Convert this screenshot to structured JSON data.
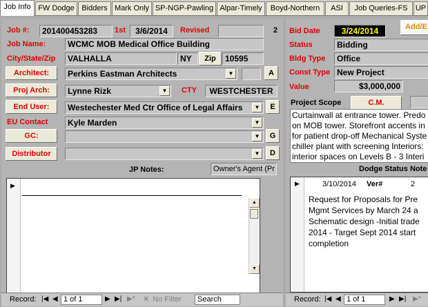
{
  "tabs": [
    "Job Info",
    "FW Dodge",
    "Bidders",
    "Mark Only",
    "SP-NGP-Pawling",
    "Alpar-Timely",
    "Boyd-Northern",
    "ASI",
    "Job Queries-FS",
    "UP"
  ],
  "left": {
    "job_no_label": "Job #:",
    "job_no": "201400453283",
    "first_label": "1st",
    "first_date": "3/6/2014",
    "revised_label": "Revised",
    "revised_value": "",
    "revision_count": "2",
    "job_name_label": "Job Name:",
    "job_name": "WCMC MOB Medical Office Building",
    "city_label": "City/State/Zip",
    "city": "VALHALLA",
    "state": "NY",
    "zip_button": "Zip",
    "zip": "10595",
    "architect_button": "Architect:",
    "architect": "Perkins Eastman Architects",
    "architect_code_button": "A",
    "proj_arch_button": "Proj Arch:",
    "proj_arch": "Lynne Rizk",
    "cty_label": "CTY",
    "cty": "WESTCHESTER",
    "end_user_button": "End User:",
    "end_user": "Westechester Med Ctr Office of Legal Affairs",
    "end_user_code_button": "E",
    "eu_contact_label": "EU Contact",
    "eu_contact": "Kyle Marden",
    "gc_button": "GC:",
    "gc": "",
    "gc_code_button": "G",
    "distributor_button": "Distributor",
    "distributor": "",
    "distributor_code_button": "D",
    "jp_notes_label": "JP Notes:",
    "jp_notes_type": "Owner's Agent (Pr",
    "nav": {
      "record_label": "Record:",
      "record_value": "1 of 1",
      "no_filter": "No Filter",
      "search": "Search"
    }
  },
  "right": {
    "add_button": "Add/E",
    "bid_date_label": "Bid Date",
    "bid_date": "3/24/2014",
    "status_label": "Status",
    "status": "Bidding",
    "bldg_type_label": "Bldg Type",
    "bldg_type": "Office",
    "const_type_label": "Const Type",
    "const_type": "New Project",
    "value_label": "Value",
    "value": "$3,000,000",
    "project_scope_label": "Project Scope",
    "cm_button": "C.M.",
    "scope_text": "Curtainwall at entrance tower. Predo\non MOB tower. Storefront accents in\nfor patient drop-off Mechanical Syste\nchiller plant with screening Interiors:\ninterior spaces on Levels B - 3 Interi",
    "dodge_status_label": "Dodge Status Note",
    "dodge_date": "3/10/2014",
    "ver_label": "Ver#",
    "ver_value": "2",
    "dodge_note": "Request for Proposals for Pre\nMgmt Services by March 24 a\nSchematic design -Initial trade\n2014 - Target Sept 2014 start\ncompletion",
    "nav": {
      "record_label": "Record:",
      "record_value": "1 of 1"
    }
  },
  "colors": {
    "label_red": "#e00000",
    "panel_gray": "#b4b4b4",
    "bid_date_bg": "#000000",
    "bid_date_fg": "#ffff00"
  }
}
